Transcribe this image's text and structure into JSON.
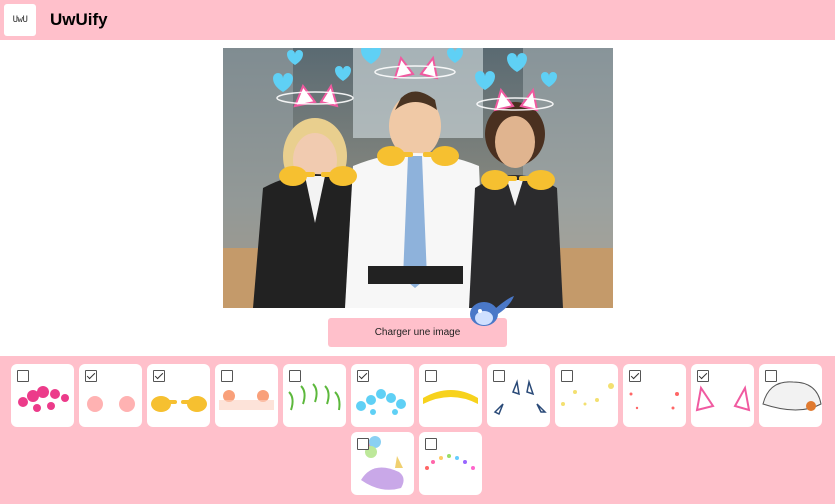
{
  "header": {
    "logo_text": "UwU",
    "title": "UwUify"
  },
  "main": {
    "upload_label": "Charger une image"
  },
  "filters": [
    {
      "id": "pink-hearts",
      "checked": false
    },
    {
      "id": "blush",
      "checked": true
    },
    {
      "id": "pointing-hands",
      "checked": true
    },
    {
      "id": "peach-blush",
      "checked": false
    },
    {
      "id": "sprouts",
      "checked": false
    },
    {
      "id": "blue-hearts",
      "checked": true
    },
    {
      "id": "flower-crown",
      "checked": false
    },
    {
      "id": "tear-drops",
      "checked": false
    },
    {
      "id": "sparkles",
      "checked": false
    },
    {
      "id": "pink-sparkles",
      "checked": true
    },
    {
      "id": "cat-ears",
      "checked": true
    },
    {
      "id": "sleeping-cat",
      "checked": false
    },
    {
      "id": "narwhal-balloons",
      "checked": false
    },
    {
      "id": "rainbow-dots",
      "checked": false
    }
  ]
}
